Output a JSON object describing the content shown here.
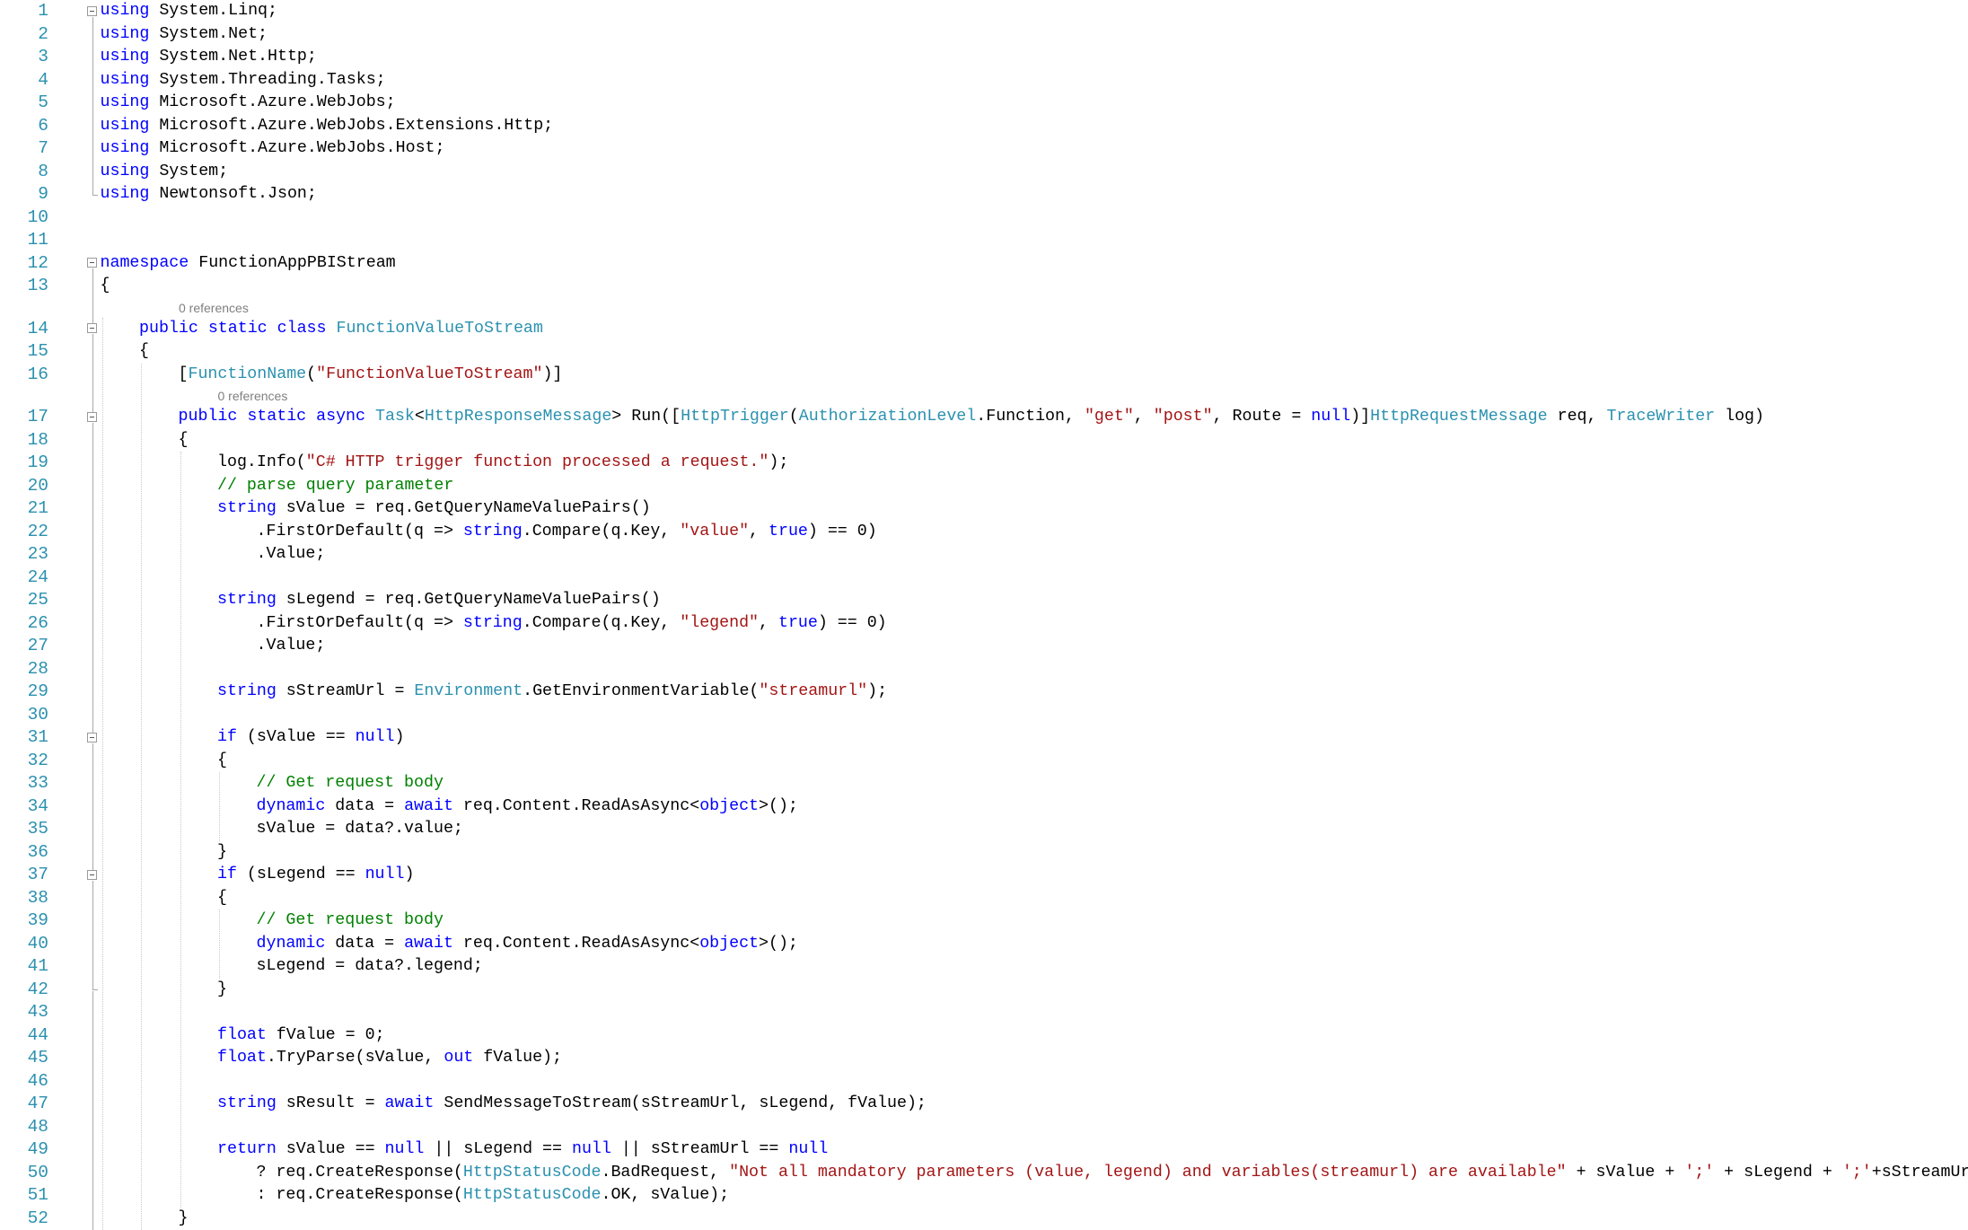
{
  "colors": {
    "keyword": "#0000FF",
    "type": "#2B91AF",
    "string": "#A31515",
    "comment": "#008000",
    "plain": "#000000",
    "line_number": "#2B91AF",
    "codelens": "#7F7F7F"
  },
  "codelens": [
    {
      "text": "0 references",
      "before_line": 14
    },
    {
      "text": "0 references",
      "before_line": 17
    }
  ],
  "lines": [
    {
      "n": "1",
      "indent": 0,
      "tokens": [
        [
          "kw",
          "using"
        ],
        [
          "pl",
          " System.Linq;"
        ]
      ]
    },
    {
      "n": "2",
      "indent": 0,
      "tokens": [
        [
          "kw",
          "using"
        ],
        [
          "pl",
          " System.Net;"
        ]
      ]
    },
    {
      "n": "3",
      "indent": 0,
      "tokens": [
        [
          "kw",
          "using"
        ],
        [
          "pl",
          " System.Net.Http;"
        ]
      ]
    },
    {
      "n": "4",
      "indent": 0,
      "tokens": [
        [
          "kw",
          "using"
        ],
        [
          "pl",
          " System.Threading.Tasks;"
        ]
      ]
    },
    {
      "n": "5",
      "indent": 0,
      "tokens": [
        [
          "kw",
          "using"
        ],
        [
          "pl",
          " Microsoft.Azure.WebJobs;"
        ]
      ]
    },
    {
      "n": "6",
      "indent": 0,
      "tokens": [
        [
          "kw",
          "using"
        ],
        [
          "pl",
          " Microsoft.Azure.WebJobs.Extensions.Http;"
        ]
      ]
    },
    {
      "n": "7",
      "indent": 0,
      "tokens": [
        [
          "kw",
          "using"
        ],
        [
          "pl",
          " Microsoft.Azure.WebJobs.Host;"
        ]
      ]
    },
    {
      "n": "8",
      "indent": 0,
      "tokens": [
        [
          "kw",
          "using"
        ],
        [
          "pl",
          " System;"
        ]
      ]
    },
    {
      "n": "9",
      "indent": 0,
      "tokens": [
        [
          "kw",
          "using"
        ],
        [
          "pl",
          " Newtonsoft.Json;"
        ]
      ]
    },
    {
      "n": "10",
      "indent": 0,
      "tokens": []
    },
    {
      "n": "11",
      "indent": 0,
      "tokens": []
    },
    {
      "n": "12",
      "indent": 0,
      "tokens": [
        [
          "kw",
          "namespace"
        ],
        [
          "pl",
          " FunctionAppPBIStream"
        ]
      ]
    },
    {
      "n": "13",
      "indent": 0,
      "tokens": [
        [
          "pl",
          "{"
        ]
      ]
    },
    {
      "n": "14",
      "indent": 1,
      "tokens": [
        [
          "kw",
          "public"
        ],
        [
          "pl",
          " "
        ],
        [
          "kw",
          "static"
        ],
        [
          "pl",
          " "
        ],
        [
          "kw",
          "class"
        ],
        [
          "pl",
          " "
        ],
        [
          "ty",
          "FunctionValueToStream"
        ]
      ]
    },
    {
      "n": "15",
      "indent": 1,
      "tokens": [
        [
          "pl",
          "{"
        ]
      ]
    },
    {
      "n": "16",
      "indent": 2,
      "tokens": [
        [
          "pl",
          "["
        ],
        [
          "ty",
          "FunctionName"
        ],
        [
          "pl",
          "("
        ],
        [
          "st",
          "\"FunctionValueToStream\""
        ],
        [
          "pl",
          ")]"
        ]
      ]
    },
    {
      "n": "17",
      "indent": 2,
      "tokens": [
        [
          "kw",
          "public"
        ],
        [
          "pl",
          " "
        ],
        [
          "kw",
          "static"
        ],
        [
          "pl",
          " "
        ],
        [
          "kw",
          "async"
        ],
        [
          "pl",
          " "
        ],
        [
          "ty",
          "Task"
        ],
        [
          "pl",
          "<"
        ],
        [
          "ty",
          "HttpResponseMessage"
        ],
        [
          "pl",
          "> Run(["
        ],
        [
          "ty",
          "HttpTrigger"
        ],
        [
          "pl",
          "("
        ],
        [
          "ty",
          "AuthorizationLevel"
        ],
        [
          "pl",
          ".Function, "
        ],
        [
          "st",
          "\"get\""
        ],
        [
          "pl",
          ", "
        ],
        [
          "st",
          "\"post\""
        ],
        [
          "pl",
          ", Route = "
        ],
        [
          "kw",
          "null"
        ],
        [
          "pl",
          ")]"
        ],
        [
          "ty",
          "HttpRequestMessage"
        ],
        [
          "pl",
          " req, "
        ],
        [
          "ty",
          "TraceWriter"
        ],
        [
          "pl",
          " log)"
        ]
      ]
    },
    {
      "n": "18",
      "indent": 2,
      "tokens": [
        [
          "pl",
          "{"
        ]
      ]
    },
    {
      "n": "19",
      "indent": 3,
      "tokens": [
        [
          "pl",
          "log.Info("
        ],
        [
          "st",
          "\"C# HTTP trigger function processed a request.\""
        ],
        [
          "pl",
          ");"
        ]
      ]
    },
    {
      "n": "20",
      "indent": 3,
      "tokens": [
        [
          "cm",
          "// parse query parameter"
        ]
      ]
    },
    {
      "n": "21",
      "indent": 3,
      "tokens": [
        [
          "kw",
          "string"
        ],
        [
          "pl",
          " sValue = req.GetQueryNameValuePairs()"
        ]
      ]
    },
    {
      "n": "22",
      "indent": 4,
      "tokens": [
        [
          "pl",
          ".FirstOrDefault(q => "
        ],
        [
          "kw",
          "string"
        ],
        [
          "pl",
          ".Compare(q.Key, "
        ],
        [
          "st",
          "\"value\""
        ],
        [
          "pl",
          ", "
        ],
        [
          "kw",
          "true"
        ],
        [
          "pl",
          ") == 0)"
        ]
      ]
    },
    {
      "n": "23",
      "indent": 4,
      "tokens": [
        [
          "pl",
          ".Value;"
        ]
      ]
    },
    {
      "n": "24",
      "indent": 0,
      "tokens": []
    },
    {
      "n": "25",
      "indent": 3,
      "tokens": [
        [
          "kw",
          "string"
        ],
        [
          "pl",
          " sLegend = req.GetQueryNameValuePairs()"
        ]
      ]
    },
    {
      "n": "26",
      "indent": 4,
      "tokens": [
        [
          "pl",
          ".FirstOrDefault(q => "
        ],
        [
          "kw",
          "string"
        ],
        [
          "pl",
          ".Compare(q.Key, "
        ],
        [
          "st",
          "\"legend\""
        ],
        [
          "pl",
          ", "
        ],
        [
          "kw",
          "true"
        ],
        [
          "pl",
          ") == 0)"
        ]
      ]
    },
    {
      "n": "27",
      "indent": 4,
      "tokens": [
        [
          "pl",
          ".Value;"
        ]
      ]
    },
    {
      "n": "28",
      "indent": 0,
      "tokens": []
    },
    {
      "n": "29",
      "indent": 3,
      "tokens": [
        [
          "kw",
          "string"
        ],
        [
          "pl",
          " sStreamUrl = "
        ],
        [
          "ty",
          "Environment"
        ],
        [
          "pl",
          ".GetEnvironmentVariable("
        ],
        [
          "st",
          "\"streamurl\""
        ],
        [
          "pl",
          ");"
        ]
      ]
    },
    {
      "n": "30",
      "indent": 0,
      "tokens": []
    },
    {
      "n": "31",
      "indent": 3,
      "tokens": [
        [
          "kw",
          "if"
        ],
        [
          "pl",
          " (sValue == "
        ],
        [
          "kw",
          "null"
        ],
        [
          "pl",
          ")"
        ]
      ]
    },
    {
      "n": "32",
      "indent": 3,
      "tokens": [
        [
          "pl",
          "{"
        ]
      ]
    },
    {
      "n": "33",
      "indent": 4,
      "tokens": [
        [
          "cm",
          "// Get request body"
        ]
      ]
    },
    {
      "n": "34",
      "indent": 4,
      "tokens": [
        [
          "kw",
          "dynamic"
        ],
        [
          "pl",
          " data = "
        ],
        [
          "kw",
          "await"
        ],
        [
          "pl",
          " req.Content.ReadAsAsync<"
        ],
        [
          "kw",
          "object"
        ],
        [
          "pl",
          ">();"
        ]
      ]
    },
    {
      "n": "35",
      "indent": 4,
      "tokens": [
        [
          "pl",
          "sValue = data?.value;"
        ]
      ]
    },
    {
      "n": "36",
      "indent": 3,
      "tokens": [
        [
          "pl",
          "}"
        ]
      ]
    },
    {
      "n": "37",
      "indent": 3,
      "tokens": [
        [
          "kw",
          "if"
        ],
        [
          "pl",
          " (sLegend == "
        ],
        [
          "kw",
          "null"
        ],
        [
          "pl",
          ")"
        ]
      ]
    },
    {
      "n": "38",
      "indent": 3,
      "tokens": [
        [
          "pl",
          "{"
        ]
      ]
    },
    {
      "n": "39",
      "indent": 4,
      "tokens": [
        [
          "cm",
          "// Get request body"
        ]
      ]
    },
    {
      "n": "40",
      "indent": 4,
      "tokens": [
        [
          "kw",
          "dynamic"
        ],
        [
          "pl",
          " data = "
        ],
        [
          "kw",
          "await"
        ],
        [
          "pl",
          " req.Content.ReadAsAsync<"
        ],
        [
          "kw",
          "object"
        ],
        [
          "pl",
          ">();"
        ]
      ]
    },
    {
      "n": "41",
      "indent": 4,
      "tokens": [
        [
          "pl",
          "sLegend = data?.legend;"
        ]
      ]
    },
    {
      "n": "42",
      "indent": 3,
      "tokens": [
        [
          "pl",
          "}"
        ]
      ]
    },
    {
      "n": "43",
      "indent": 0,
      "tokens": []
    },
    {
      "n": "44",
      "indent": 3,
      "tokens": [
        [
          "kw",
          "float"
        ],
        [
          "pl",
          " fValue = 0;"
        ]
      ]
    },
    {
      "n": "45",
      "indent": 3,
      "tokens": [
        [
          "kw",
          "float"
        ],
        [
          "pl",
          ".TryParse(sValue, "
        ],
        [
          "kw",
          "out"
        ],
        [
          "pl",
          " fValue);"
        ]
      ]
    },
    {
      "n": "46",
      "indent": 0,
      "tokens": []
    },
    {
      "n": "47",
      "indent": 3,
      "tokens": [
        [
          "kw",
          "string"
        ],
        [
          "pl",
          " sResult = "
        ],
        [
          "kw",
          "await"
        ],
        [
          "pl",
          " SendMessageToStream(sStreamUrl, sLegend, fValue);"
        ]
      ]
    },
    {
      "n": "48",
      "indent": 0,
      "tokens": []
    },
    {
      "n": "49",
      "indent": 3,
      "tokens": [
        [
          "kw",
          "return"
        ],
        [
          "pl",
          " sValue == "
        ],
        [
          "kw",
          "null"
        ],
        [
          "pl",
          " || sLegend == "
        ],
        [
          "kw",
          "null"
        ],
        [
          "pl",
          " || sStreamUrl == "
        ],
        [
          "kw",
          "null"
        ]
      ]
    },
    {
      "n": "50",
      "indent": 4,
      "tokens": [
        [
          "pl",
          "? req.CreateResponse("
        ],
        [
          "ty",
          "HttpStatusCode"
        ],
        [
          "pl",
          ".BadRequest, "
        ],
        [
          "st",
          "\"Not all mandatory parameters (value, legend) and variables(streamurl) are available\""
        ],
        [
          "pl",
          " + sValue + "
        ],
        [
          "st",
          "';'"
        ],
        [
          "pl",
          " + sLegend + "
        ],
        [
          "st",
          "';'"
        ],
        [
          "pl",
          "+sStreamUrl)"
        ]
      ]
    },
    {
      "n": "51",
      "indent": 4,
      "tokens": [
        [
          "pl",
          ": req.CreateResponse("
        ],
        [
          "ty",
          "HttpStatusCode"
        ],
        [
          "pl",
          ".OK, sValue);"
        ]
      ]
    },
    {
      "n": "52",
      "indent": 2,
      "tokens": [
        [
          "pl",
          "}"
        ]
      ]
    }
  ]
}
